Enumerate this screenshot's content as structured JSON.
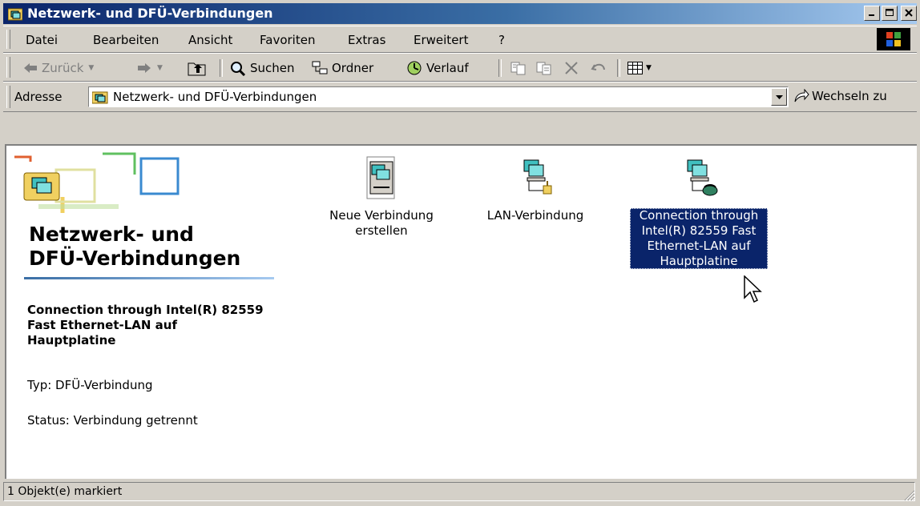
{
  "window": {
    "title": "Netzwerk- und DFÜ-Verbindungen",
    "buttons": [
      "minimize-icon",
      "maximize-icon",
      "close-icon"
    ]
  },
  "menu": {
    "items": [
      "Datei",
      "Bearbeiten",
      "Ansicht",
      "Favoriten",
      "Extras",
      "Erweitert",
      "?"
    ]
  },
  "toolbar": {
    "back_label": "Zurück",
    "search_label": "Suchen",
    "folders_label": "Ordner",
    "history_label": "Verlauf"
  },
  "address": {
    "label": "Adresse",
    "value": "Netzwerk- und DFÜ-Verbindungen",
    "go_label": "Wechseln zu"
  },
  "left_panel": {
    "title_line1": "Netzwerk- und",
    "title_line2": "DFÜ-Verbindungen",
    "selected_name": "Connection through Intel(R) 82559 Fast Ethernet-LAN auf Hauptplatine",
    "type_text": "Typ: DFÜ-Verbindung",
    "status_text": "Status: Verbindung getrennt"
  },
  "icons": [
    {
      "label_line1": "Neue Verbindung",
      "label_line2": "erstellen",
      "icon": "new-connection-icon",
      "selected": false
    },
    {
      "label_line1": "LAN-Verbindung",
      "icon": "lan-connection-icon",
      "selected": false
    },
    {
      "label_line1": "Connection through",
      "label_line2": "Intel(R) 82559 Fast",
      "label_line3": "Ethernet-LAN auf",
      "label_line4": "Hauptplatine",
      "icon": "dialup-connection-icon",
      "selected": true
    }
  ],
  "statusbar": {
    "text": "1 Objekt(e) markiert"
  },
  "colors": {
    "titlebar_start": "#0a246a",
    "titlebar_end": "#a6caf0",
    "selection": "#0a246a",
    "face": "#d4d0c8"
  }
}
